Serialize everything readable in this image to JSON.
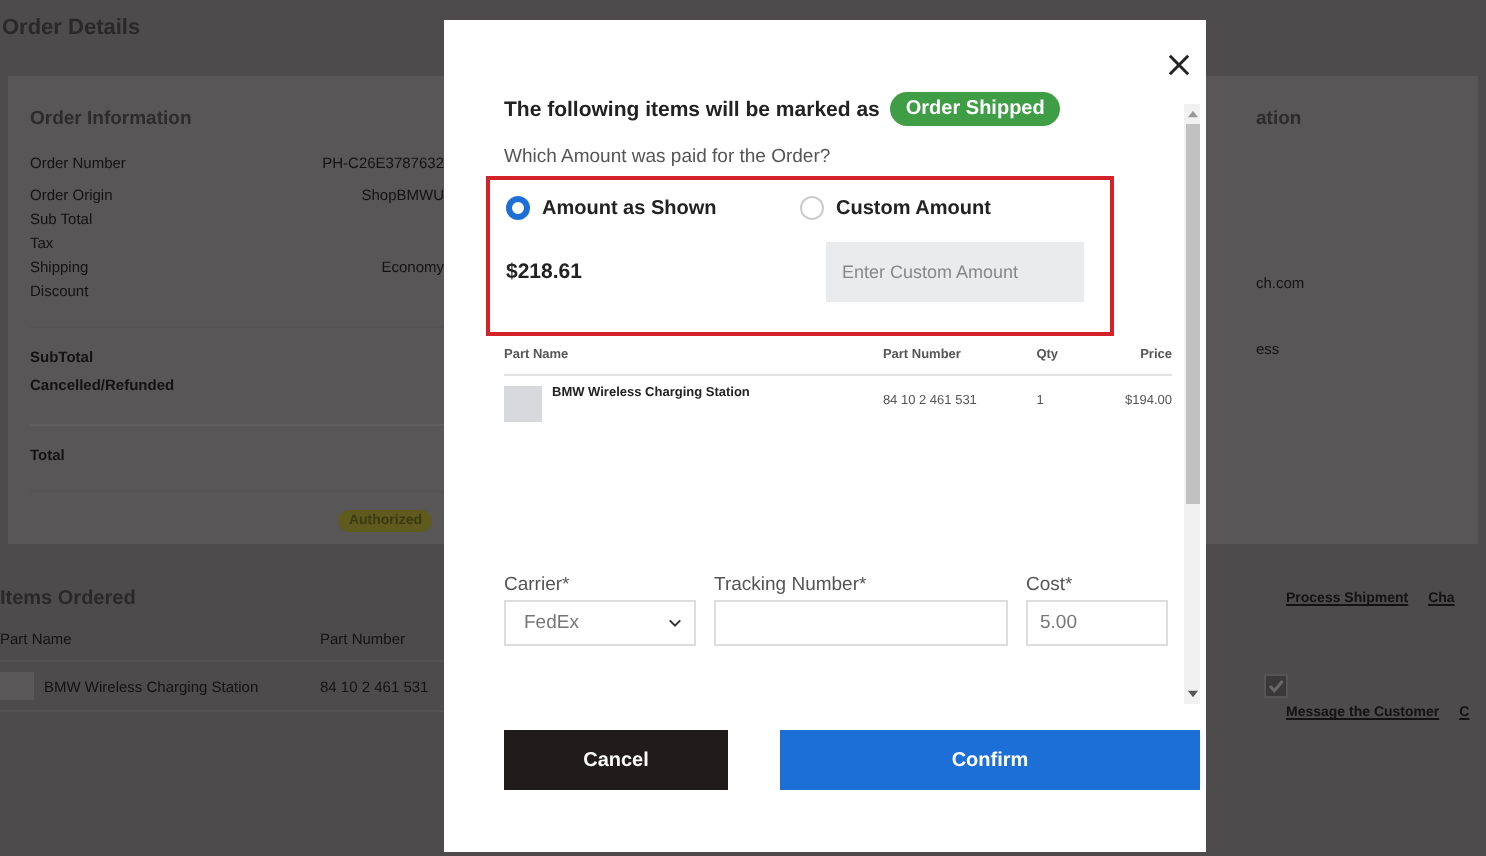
{
  "page": {
    "title": "Order Details"
  },
  "order_information": {
    "title": "Order Information",
    "rows": [
      {
        "label": "Order Number",
        "value": "PH-C26E3787632"
      },
      {
        "label": "Order Origin",
        "value": "ShopBMWU"
      },
      {
        "label": "Sub Total"
      },
      {
        "label": "Tax"
      },
      {
        "label": "Shipping",
        "value": "Economy"
      },
      {
        "label": "Discount"
      }
    ],
    "totals": [
      "SubTotal",
      "Cancelled/Refunded",
      "Total"
    ],
    "status_badge": "Authorized"
  },
  "items_ordered": {
    "title": "Items Ordered",
    "columns": [
      "Part Name",
      "Part Number"
    ],
    "rows": [
      {
        "part_name": "BMW Wireless Charging Station",
        "part_number": "84 10 2 461 531"
      }
    ]
  },
  "right_panel": {
    "title_fragment": "ation",
    "texts": [
      "ch.com",
      "ess"
    ],
    "actions": [
      "Process Shipment",
      "Cha"
    ],
    "item_checked": true,
    "footer_links": [
      "Message the Customer",
      "C"
    ]
  },
  "modal": {
    "heading": "The following items will be marked as",
    "status_badge": "Order Shipped",
    "question": "Which Amount was paid for the Order?",
    "options": [
      {
        "label": "Amount as Shown",
        "selected": true
      },
      {
        "label": "Custom Amount",
        "selected": false
      }
    ],
    "amount": "$218.61",
    "custom_amount": {
      "placeholder": "Enter Custom Amount"
    },
    "table": {
      "columns": [
        "Part Name",
        "Part Number",
        "Qty",
        "Price"
      ],
      "rows": [
        {
          "cells": [
            "BMW Wireless Charging Station",
            "84 10 2 461 531",
            "1",
            "$194.00"
          ]
        }
      ]
    },
    "fields": [
      {
        "kind": "select",
        "label": "Carrier*",
        "value": "FedEx"
      },
      {
        "kind": "text",
        "label": "Tracking Number*"
      },
      {
        "kind": "text",
        "label": "Cost*",
        "value": "5.00"
      }
    ],
    "buttons": [
      {
        "label": "Cancel",
        "kind": "secondary"
      },
      {
        "label": "Confirm",
        "kind": "primary"
      }
    ]
  }
}
